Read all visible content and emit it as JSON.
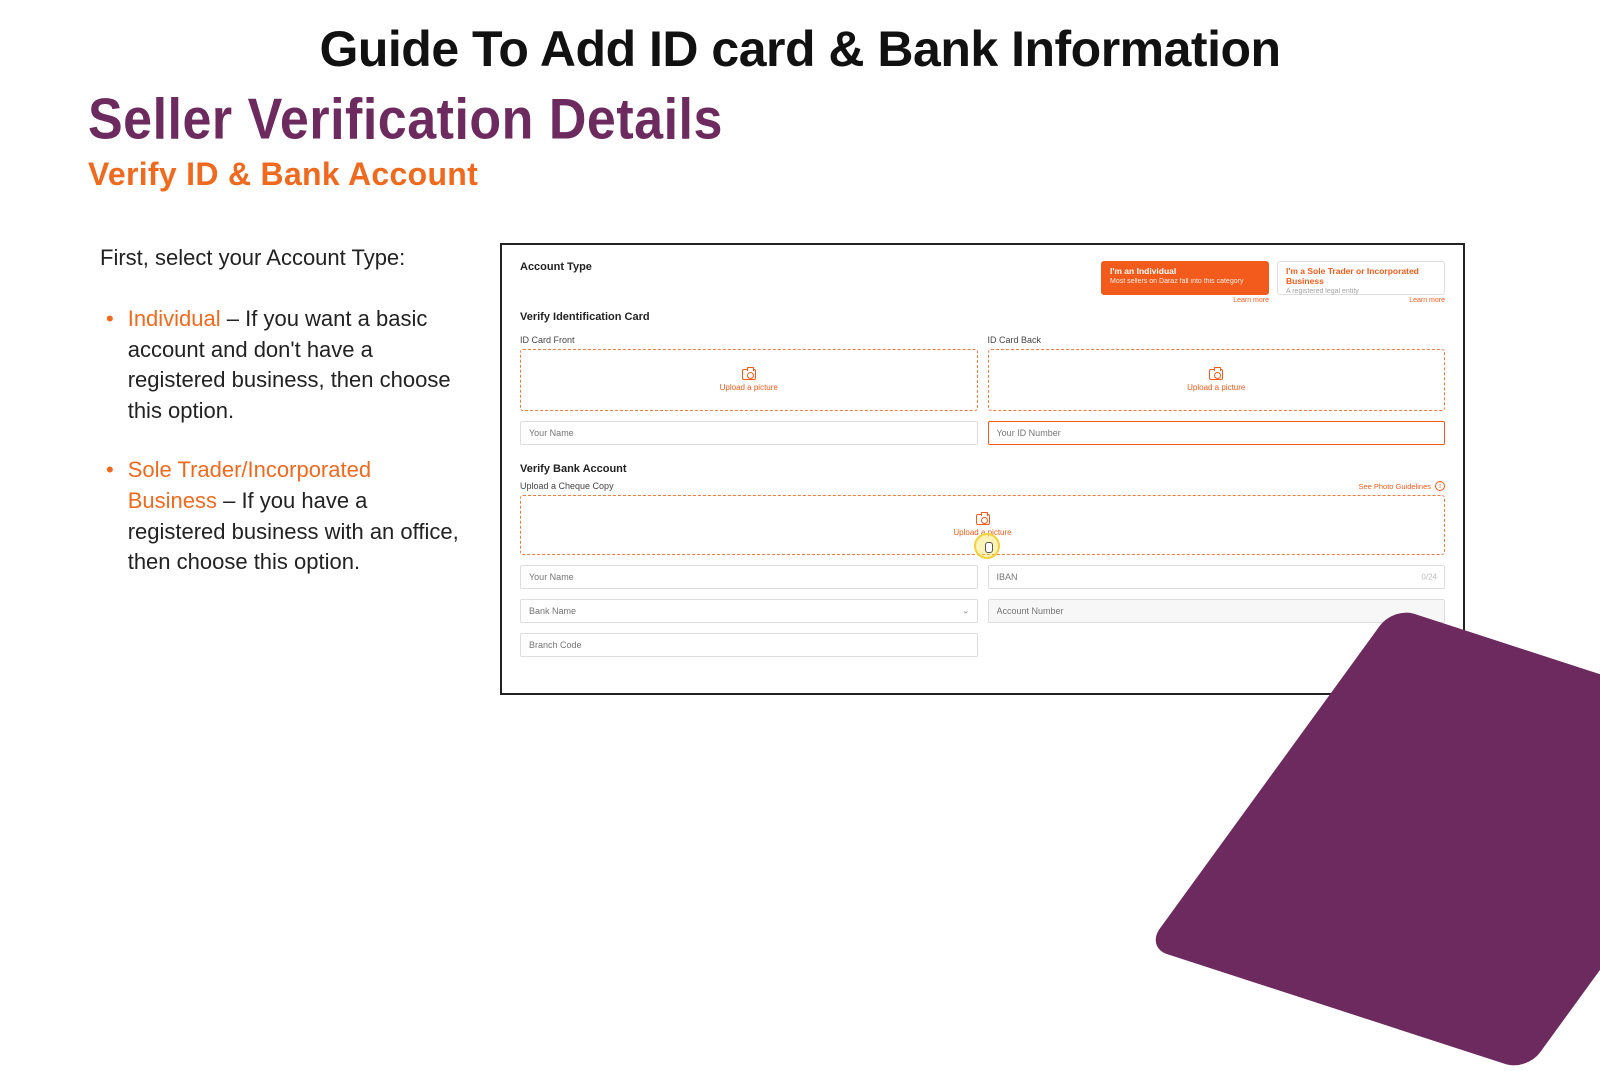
{
  "slide": {
    "title": "Guide To  Add ID card & Bank Information",
    "heading_purple": "Seller Verification Details",
    "heading_orange": "Verify ID & Bank Account",
    "intro": "First, select your Account Type:",
    "bullets": [
      {
        "term": "Individual",
        "rest": " – If you want a basic account and don't have a registered business, then choose this option."
      },
      {
        "term": "Sole Trader/Incorporated Business",
        "rest": " – If you have a registered business with an office, then choose this option."
      }
    ]
  },
  "form": {
    "account_type_label": "Account Type",
    "card_individual": {
      "title": "I'm an Individual",
      "sub": "Most sellers on Daraz fall into this category",
      "learn": "Learn more"
    },
    "card_business": {
      "title": "I'm a Sole Trader or Incorporated Business",
      "sub": "A registered legal entity",
      "learn": "Learn more"
    },
    "verify_id_label": "Verify Identification Card",
    "id_front_label": "ID Card Front",
    "id_back_label": "ID Card Back",
    "upload_text": "Upload a picture",
    "your_name_ph": "Your Name",
    "your_id_ph": "Your ID Number",
    "verify_bank_label": "Verify Bank Account",
    "cheque_label": "Upload a Cheque Copy",
    "see_guide": "See Photo Guidelines",
    "info_i": "i",
    "bank_your_name_ph": "Your Name",
    "iban_ph": "IBAN",
    "iban_counter": "0/24",
    "bank_name_ph": "Bank Name",
    "account_num_ph": "Account Number",
    "branch_code_ph": "Branch Code"
  }
}
